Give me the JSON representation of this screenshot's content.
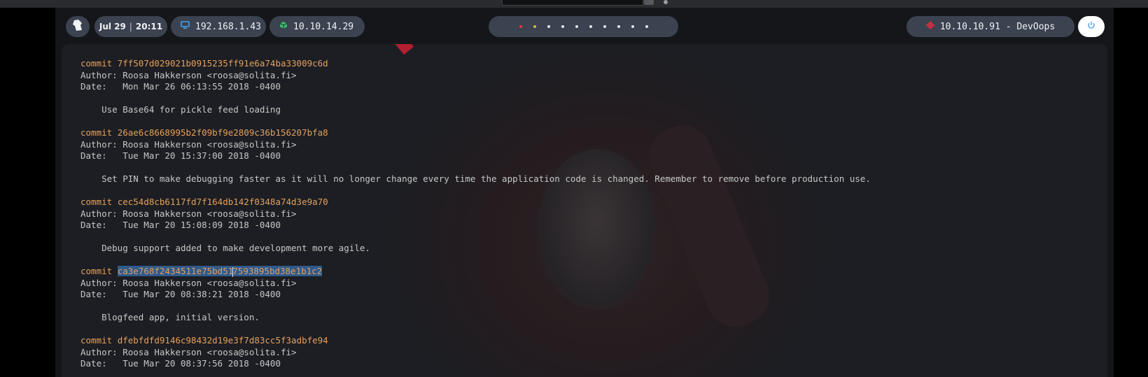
{
  "header": {
    "clock_date": "Jul 29",
    "clock_time": "20:11",
    "local_ip": "192.168.1.43",
    "vpn_ip": "10.10.14.29",
    "target": "10.10.10.91 - DevOops",
    "workspaces_count": 10,
    "workspace_colors": [
      "#e03a3a",
      "#e8b339",
      "#e6e8ec",
      "#e6e8ec",
      "#e6e8ec",
      "#e6e8ec",
      "#e6e8ec",
      "#e6e8ec",
      "#e6e8ec",
      "#e6e8ec"
    ]
  },
  "icons": {
    "logo": "parrot-logo-icon",
    "local_ip": "monitor-icon",
    "vpn_ip": "vpn-cube-icon",
    "target": "crosshair-icon",
    "power": "power-icon"
  },
  "colors": {
    "commit": "#e5a05c",
    "text": "#c5c8c6",
    "selection": "#2f5a8c",
    "pill": "#3b4250",
    "vpn": "#3bb86f",
    "monitor": "#4aa0e6",
    "target": "#e0323c",
    "power": "#4aa0e6"
  },
  "terminal": {
    "commits": [
      {
        "label": "commit",
        "hash": "7ff507d029021b0915235ff91e6a74ba33009c6d",
        "author": "Author: Roosa Hakkerson <roosa@solita.fi>",
        "date": "Date:   Mon Mar 26 06:13:55 2018 -0400",
        "message": "    Use Base64 for pickle feed loading"
      },
      {
        "label": "commit",
        "hash": "26ae6c8668995b2f09bf9e2809c36b156207bfa8",
        "author": "Author: Roosa Hakkerson <roosa@solita.fi>",
        "date": "Date:   Tue Mar 20 15:37:00 2018 -0400",
        "message": "    Set PIN to make debugging faster as it will no longer change every time the application code is changed. Remember to remove before production use."
      },
      {
        "label": "commit",
        "hash": "cec54d8cb6117fd7f164db142f0348a74d3e9a70",
        "author": "Author: Roosa Hakkerson <roosa@solita.fi>",
        "date": "Date:   Tue Mar 20 15:08:09 2018 -0400",
        "message": "    Debug support added to make development more agile."
      },
      {
        "label": "commit",
        "hash_before_cursor": "ca3e768f2434511e75bd51",
        "hash_after_cursor": "7593895bd38e1b1c2",
        "author": "Author: Roosa Hakkerson <roosa@solita.fi>",
        "date": "Date:   Tue Mar 20 08:38:21 2018 -0400",
        "message": "    Blogfeed app, initial version."
      },
      {
        "label": "commit",
        "hash": "dfebfdfd9146c98432d19e3f7d83cc5f3adbfe94",
        "author": "Author: Roosa Hakkerson <roosa@solita.fi>",
        "date": "Date:   Tue Mar 20 08:37:56 2018 -0400"
      }
    ]
  }
}
